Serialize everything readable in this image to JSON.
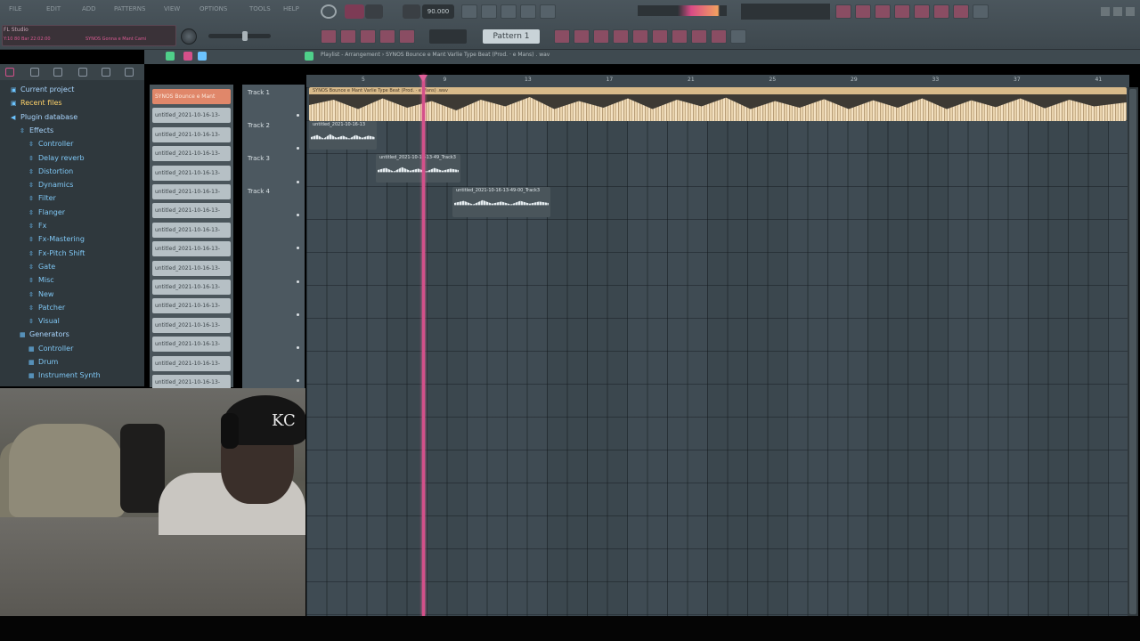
{
  "titlebox": {
    "app_name": "FL Studio",
    "hint_left": "Y:10 80 Bar 22:02:00",
    "hint_right": "SYNOS Gonna e Mant Cami"
  },
  "menu": [
    "FILE",
    "EDIT",
    "ADD",
    "PATTERNS",
    "VIEW",
    "OPTIONS",
    "TOOLS",
    "HELP"
  ],
  "transport": {
    "tempo": "90.000",
    "pattern_name": "Pattern 1"
  },
  "playlist_title": "Playlist - Arrangement › SYNOS Bounce e Mant Varlie Type Beat (Prod. · e Mans) . wav",
  "browser": {
    "items": [
      {
        "label": "Current project",
        "kind": "header",
        "glyph": "▣"
      },
      {
        "label": "Recent files",
        "kind": "header2",
        "glyph": "▣"
      },
      {
        "label": "Plugin database",
        "kind": "header",
        "glyph": "◀"
      },
      {
        "label": "Effects",
        "kind": "header",
        "glyph": "⇳"
      },
      {
        "label": "Controller",
        "kind": "leaf",
        "glyph": "⇳"
      },
      {
        "label": "Delay reverb",
        "kind": "leaf",
        "glyph": "⇳"
      },
      {
        "label": "Distortion",
        "kind": "leaf",
        "glyph": "⇳"
      },
      {
        "label": "Dynamics",
        "kind": "leaf",
        "glyph": "⇳"
      },
      {
        "label": "Filter",
        "kind": "leaf",
        "glyph": "⇳"
      },
      {
        "label": "Flanger",
        "kind": "leaf",
        "glyph": "⇳"
      },
      {
        "label": "Fx",
        "kind": "leaf",
        "glyph": "⇳"
      },
      {
        "label": "Fx-Mastering",
        "kind": "leaf",
        "glyph": "⇳"
      },
      {
        "label": "Fx-Pitch Shift",
        "kind": "leaf",
        "glyph": "⇳"
      },
      {
        "label": "Gate",
        "kind": "leaf",
        "glyph": "⇳"
      },
      {
        "label": "Misc",
        "kind": "leaf",
        "glyph": "⇳"
      },
      {
        "label": "New",
        "kind": "leaf",
        "glyph": "⇳"
      },
      {
        "label": "Patcher",
        "kind": "leaf",
        "glyph": "⇳"
      },
      {
        "label": "Visual",
        "kind": "leaf",
        "glyph": "⇳"
      },
      {
        "label": "Generators",
        "kind": "header",
        "glyph": "▦"
      },
      {
        "label": "Controller",
        "kind": "leaf",
        "glyph": "▦"
      },
      {
        "label": "Drum",
        "kind": "leaf",
        "glyph": "▦"
      },
      {
        "label": "Instrument Synth",
        "kind": "leaf",
        "glyph": "▦"
      }
    ]
  },
  "clip_list": [
    "SYNOS Bounce e Mant",
    "untitled_2021-10-16-13-",
    "untitled_2021-10-16-13-",
    "untitled_2021-10-16-13-",
    "untitled_2021-10-16-13-",
    "untitled_2021-10-16-13-",
    "untitled_2021-10-16-13-",
    "untitled_2021-10-16-13-",
    "untitled_2021-10-16-13-",
    "untitled_2021-10-16-13-",
    "untitled_2021-10-16-13-",
    "untitled_2021-10-16-13-",
    "untitled_2021-10-16-13-",
    "untitled_2021-10-16-13-",
    "untitled_2021-10-16-13-",
    "untitled_2021-10-16-13-"
  ],
  "tracks": [
    "Track 1",
    "Track 2",
    "Track 3",
    "Track 4"
  ],
  "timeline_bars": [
    "5",
    "9",
    "13",
    "17",
    "21",
    "25",
    "29",
    "33",
    "37",
    "41"
  ],
  "clips": {
    "main": "SYNOS Bounce e Mant Varlie Type Beat (Prod. · e Mans) .wav",
    "track2": "untitled_2021-10-16-13",
    "track3": "untitled_2021-10-16-13-49_Track3",
    "track4": "untitled_2021-10-16-13-49-00_Track3"
  },
  "webcam": {
    "cap_logo": "KC"
  },
  "colors": {
    "accent_pink": "#d4508a",
    "clip_tan": "#d8ba8a",
    "grid_bg": "#3f4b53"
  }
}
